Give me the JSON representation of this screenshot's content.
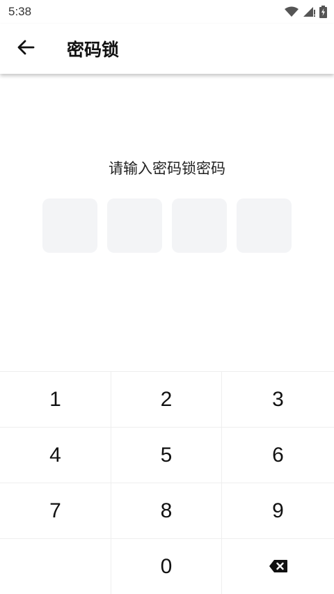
{
  "status_bar": {
    "time": "5:38",
    "icons": [
      "wifi-icon",
      "cellular-signal-icon",
      "battery-charging-icon"
    ]
  },
  "app_bar": {
    "back_icon": "arrow-left-icon",
    "title": "密码锁"
  },
  "prompt": "请输入密码锁密码",
  "pin": {
    "length": 4,
    "entered": 0
  },
  "keypad": {
    "keys": [
      "1",
      "2",
      "3",
      "4",
      "5",
      "6",
      "7",
      "8",
      "9",
      "",
      "0",
      "backspace-icon"
    ]
  },
  "colors": {
    "pin_box_bg": "#f3f4f6",
    "divider": "#eeeeee",
    "text": "#111111"
  }
}
